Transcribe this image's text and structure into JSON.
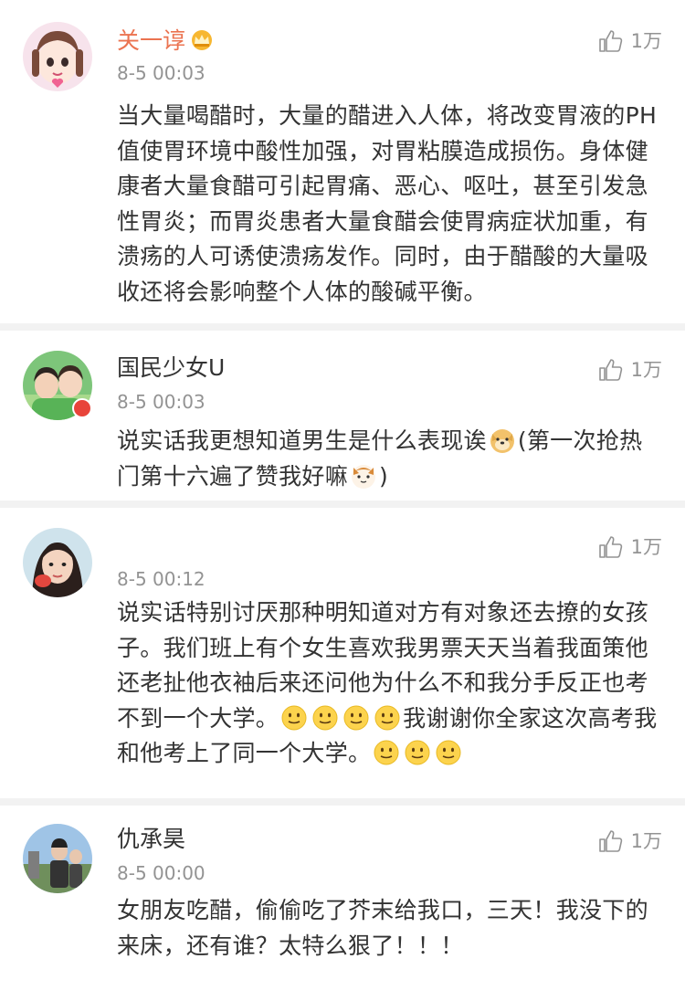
{
  "comments": [
    {
      "username": "关一谆",
      "time": "8-5 00:03",
      "likes": "1万",
      "text": "当大量喝醋时，大量的醋进入人体，将改变胃液的PH值使胃环境中酸性加强，对胃粘膜造成损伤。身体健康者大量食醋可引起胃痛、恶心、呕吐，甚至引发急性胃炎；而胃炎患者大量食醋会使胃病症状加重，有溃疡的人可诱使溃疡发作。同时，由于醋酸的大量吸收还将会影响整个人体的酸碱平衡。"
    },
    {
      "username": "国民少女U",
      "time": "8-5 00:03",
      "likes": "1万",
      "text_a": "说实话我更想知道男生是什么表现诶",
      "text_b": "(第一次抢热门第十六遍了赞我好嘛",
      "text_c": ")"
    },
    {
      "username": "",
      "time": "8-5 00:12",
      "likes": "1万",
      "text_a": "说实话特别讨厌那种明知道对方有对象还去撩的女孩子。我们班上有个女生喜欢我男票天天当着我面策他还老扯他衣袖后来还问他为什么不和我分手反正也考不到一个大学。",
      "text_b": "我谢谢你全家这次高考我和他考上了同一个大学。"
    },
    {
      "username": "仇承昊",
      "time": "8-5 00:00",
      "likes": "1万",
      "text": "女朋友吃醋，偷偷吃了芥末给我口，三天！我没下的来床，还有谁？太特么狠了！！！"
    }
  ],
  "colors": {
    "vip_name": "#eb7350",
    "meta": "#939393",
    "separator": "#f2f2f2"
  },
  "icons": {
    "like": "thumbs-up-icon",
    "vip_crown": "crown-icon",
    "smile": "smile-emoji-icon",
    "doge": "doge-emoji-icon",
    "cat": "cat-emoji-icon"
  }
}
